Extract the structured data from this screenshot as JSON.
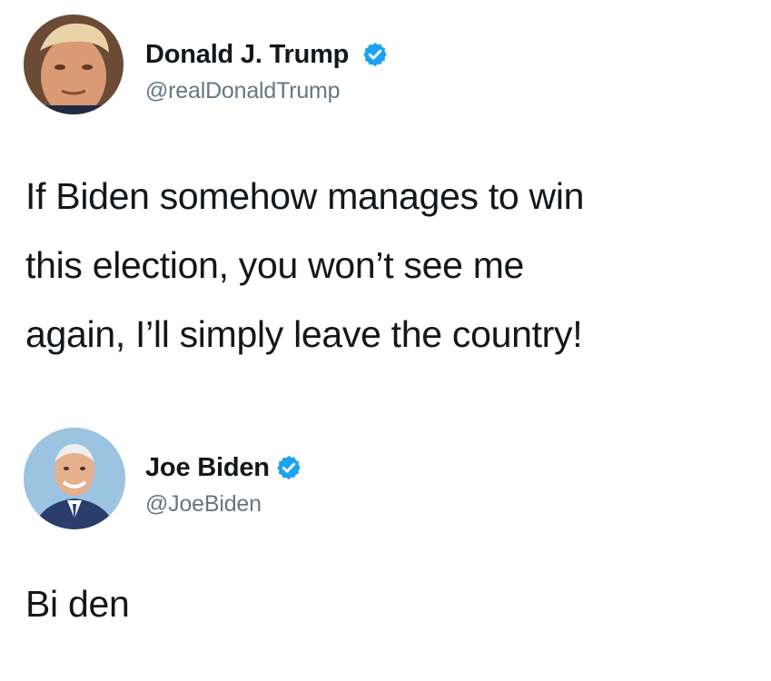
{
  "tweets": [
    {
      "name": "Donald J. Trump",
      "handle": "@realDonaldTrump",
      "verified": true,
      "avatar_icon": "trump-avatar",
      "lines": [
        "If Biden somehow manages to win",
        "this election, you won’t see me",
        "again, I’ll simply leave the country!"
      ]
    },
    {
      "name": "Joe Biden",
      "handle": "@JoeBiden",
      "verified": true,
      "avatar_icon": "biden-avatar",
      "lines": [
        "Bi den"
      ]
    }
  ],
  "colors": {
    "verified_blue": "#1da1f2",
    "handle_gray": "#657786",
    "text": "#14171a"
  }
}
